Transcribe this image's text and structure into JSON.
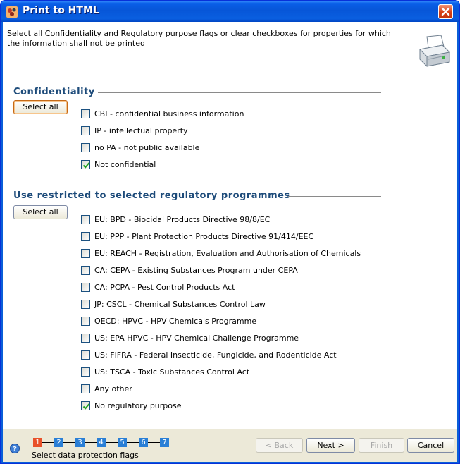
{
  "window": {
    "title": "Print to HTML",
    "app_icon": "iuclid-app-icon",
    "close_icon": "close-icon"
  },
  "header": {
    "instruction": "Select all Confidentiality and Regulatory purpose flags or clear checkboxes for properties for which the information shall not be printed",
    "icon": "printer-icon"
  },
  "confidentiality": {
    "title": "Confidentiality",
    "select_all_label": "Select all",
    "items": [
      {
        "label": "CBI - confidential business information",
        "checked": false
      },
      {
        "label": "IP - intellectual property",
        "checked": false
      },
      {
        "label": "no PA - not public available",
        "checked": false
      },
      {
        "label": "Not confidential",
        "checked": true
      }
    ]
  },
  "regulatory": {
    "title": "Use restricted to selected regulatory programmes",
    "select_all_label": "Select all",
    "items": [
      {
        "label": "EU: BPD - Biocidal Products Directive 98/8/EC",
        "checked": false
      },
      {
        "label": "EU: PPP - Plant Protection Products Directive 91/414/EEC",
        "checked": false
      },
      {
        "label": "EU: REACH - Registration, Evaluation and Authorisation of Chemicals",
        "checked": false
      },
      {
        "label": "CA: CEPA - Existing Substances Program under CEPA",
        "checked": false
      },
      {
        "label": "CA: PCPA - Pest Control Products Act",
        "checked": false
      },
      {
        "label": "JP: CSCL - Chemical Substances Control Law",
        "checked": false
      },
      {
        "label": "OECD: HPVC - HPV Chemicals Programme",
        "checked": false
      },
      {
        "label": "US: EPA HPVC - HPV Chemical Challenge Programme",
        "checked": false
      },
      {
        "label": "US: FIFRA - Federal Insecticide, Fungicide, and Rodenticide Act",
        "checked": false
      },
      {
        "label": "US: TSCA - Toxic Substances Control Act",
        "checked": false
      },
      {
        "label": "Any other",
        "checked": false
      },
      {
        "label": "No regulatory purpose",
        "checked": true
      }
    ]
  },
  "footer": {
    "help_icon": "help-icon",
    "steps": [
      "1",
      "2",
      "3",
      "4",
      "5",
      "6",
      "7"
    ],
    "current_step": 1,
    "step_caption": "Select data protection flags",
    "back_label": "< Back",
    "next_label": "Next >",
    "finish_label": "Finish",
    "cancel_label": "Cancel"
  },
  "colors": {
    "titlebar": "#0a5fd8",
    "section_title": "#1d4b7a",
    "current_step": "#e8512a",
    "other_step": "#2a7fd6",
    "check_mark": "#21a121"
  }
}
